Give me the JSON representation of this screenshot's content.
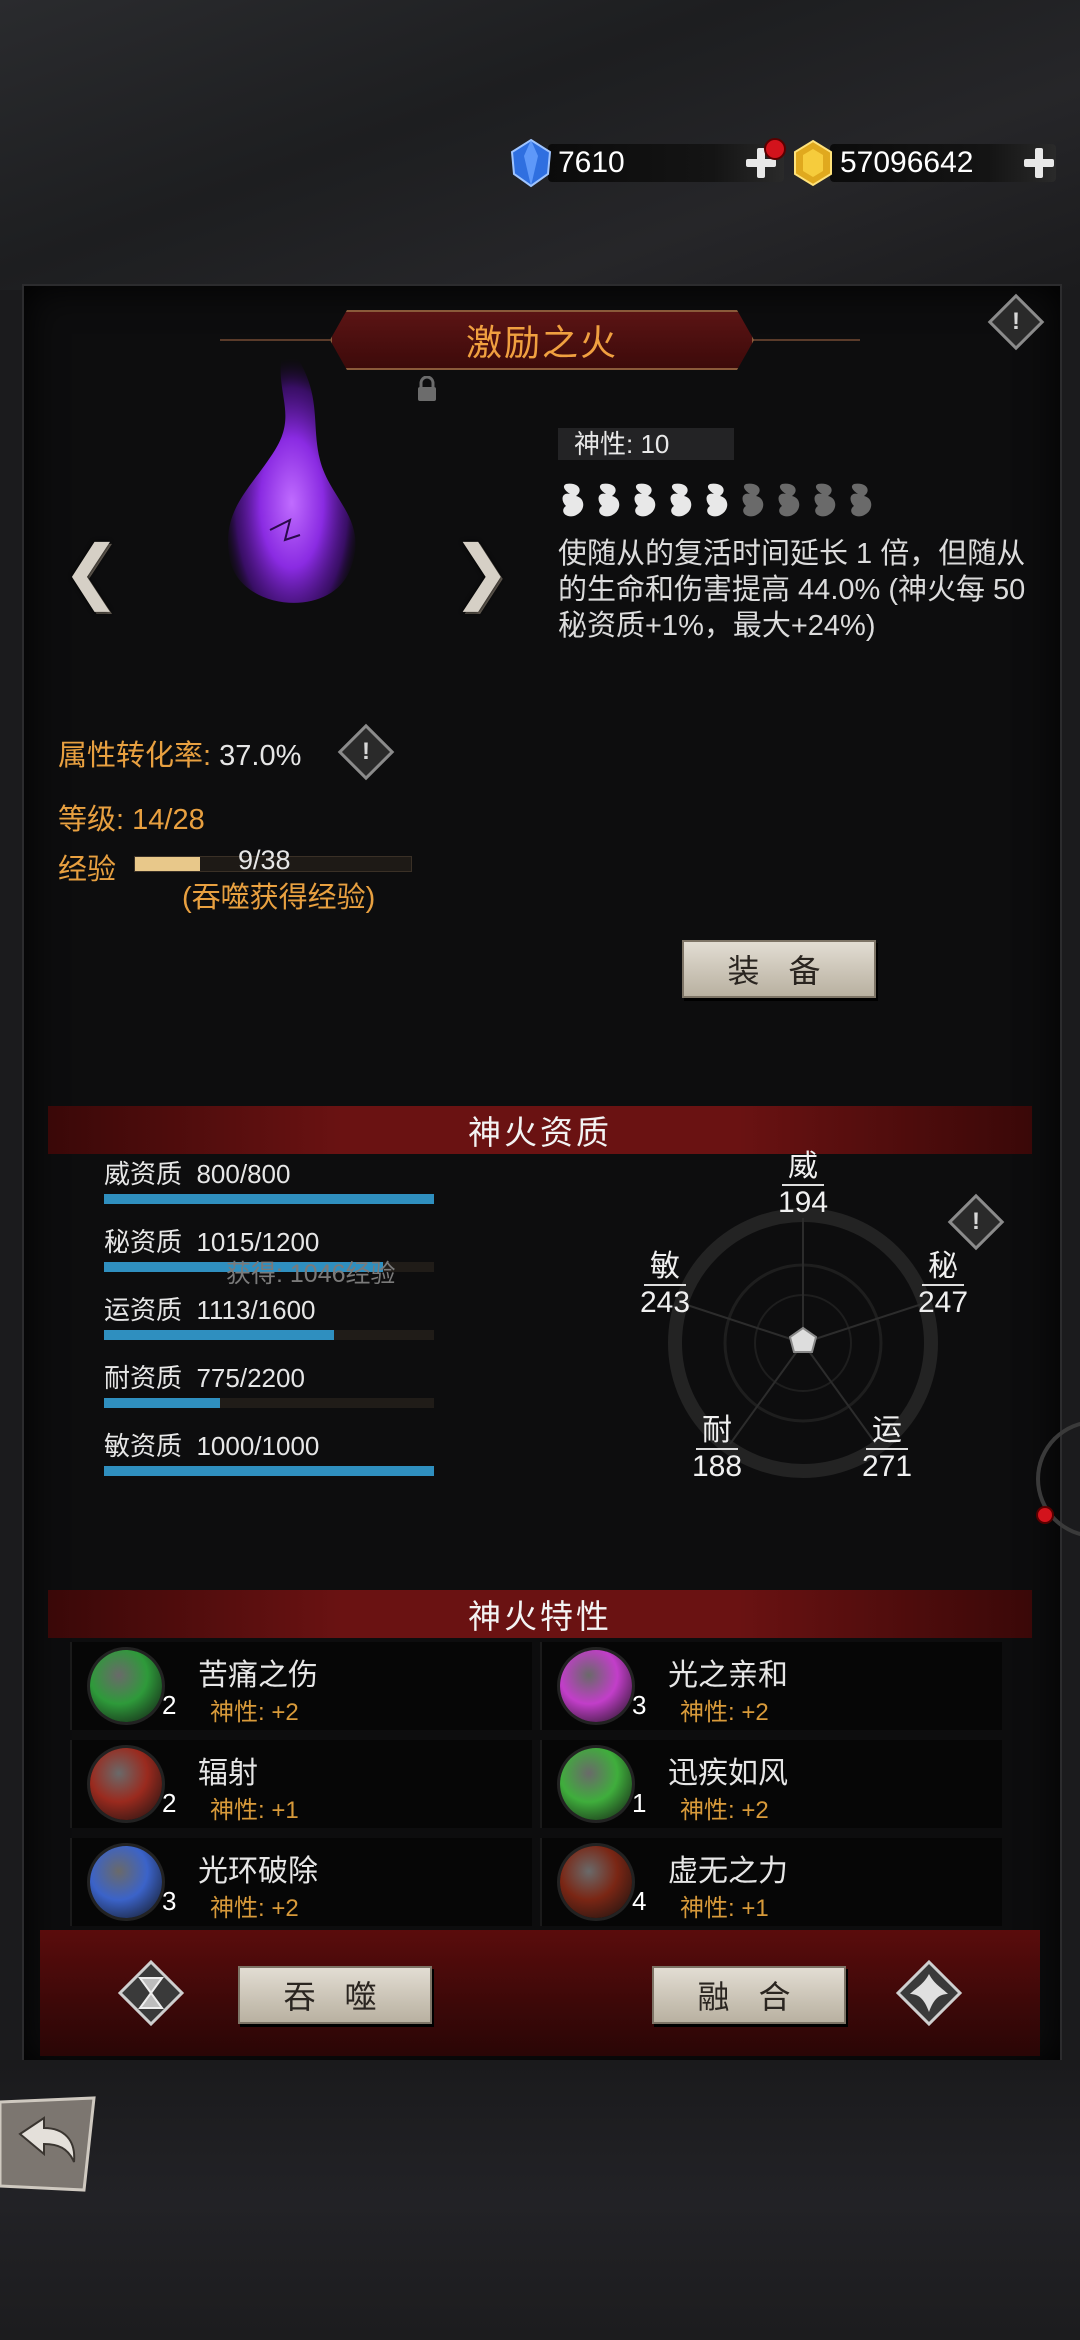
{
  "currency": {
    "crystal": "7610",
    "gold": "57096642"
  },
  "fire": {
    "name": "激励之火",
    "divinity": "神性: 10",
    "divinity_level": 5,
    "divinity_max": 9,
    "description": "使随从的复活时间延长 1 倍，但随从的生命和伤害提高 44.0% (神火每 50 秘资质+1%，最大+24%)",
    "conversion_label": "属性转化率: ",
    "conversion_value": "37.0%",
    "level_label": "等级: ",
    "level_value": "14/28",
    "exp_label": "经验",
    "exp_value": "9/38",
    "exp_fraction": 0.237,
    "exp_hint": "(吞噬获得经验)",
    "equip_button": "装 备"
  },
  "aptitude": {
    "title": "神火资质",
    "float_text": "获得: 1046经验",
    "rows": [
      {
        "label": "威资质",
        "value": "800/800",
        "fraction": 1.0
      },
      {
        "label": "秘资质",
        "value": "1015/1200",
        "fraction": 0.846
      },
      {
        "label": "运资质",
        "value": "1113/1600",
        "fraction": 0.696
      },
      {
        "label": "耐资质",
        "value": "775/2200",
        "fraction": 0.352
      },
      {
        "label": "敏资质",
        "value": "1000/1000",
        "fraction": 1.0
      }
    ],
    "radar": [
      {
        "label": "威",
        "value": "194"
      },
      {
        "label": "秘",
        "value": "247"
      },
      {
        "label": "运",
        "value": "271"
      },
      {
        "label": "耐",
        "value": "188"
      },
      {
        "label": "敏",
        "value": "243"
      }
    ]
  },
  "traits": {
    "title": "神火特性",
    "items": [
      {
        "name": "苦痛之伤",
        "level": "2",
        "divinity": "神性: +2",
        "color": "#2e9a3a",
        "icon": "poison-skull-icon"
      },
      {
        "name": "光之亲和",
        "level": "3",
        "divinity": "神性: +2",
        "color": "#c23ec9",
        "icon": "lightning-orb-icon"
      },
      {
        "name": "辐射",
        "level": "2",
        "divinity": "神性: +1",
        "color": "#9a2a1e",
        "icon": "radiation-icon"
      },
      {
        "name": "迅疾如风",
        "level": "1",
        "divinity": "神性: +2",
        "color": "#3fae3c",
        "icon": "wind-swirl-icon"
      },
      {
        "name": "光环破除",
        "level": "3",
        "divinity": "神性: +2",
        "color": "#3b63c9",
        "icon": "lightning-ring-icon"
      },
      {
        "name": "虚无之力",
        "level": "4",
        "divinity": "神性: +1",
        "color": "#7a2614",
        "icon": "void-egg-icon"
      }
    ]
  },
  "footer": {
    "devour_button": "吞 噬",
    "fuse_button": "融 合"
  }
}
